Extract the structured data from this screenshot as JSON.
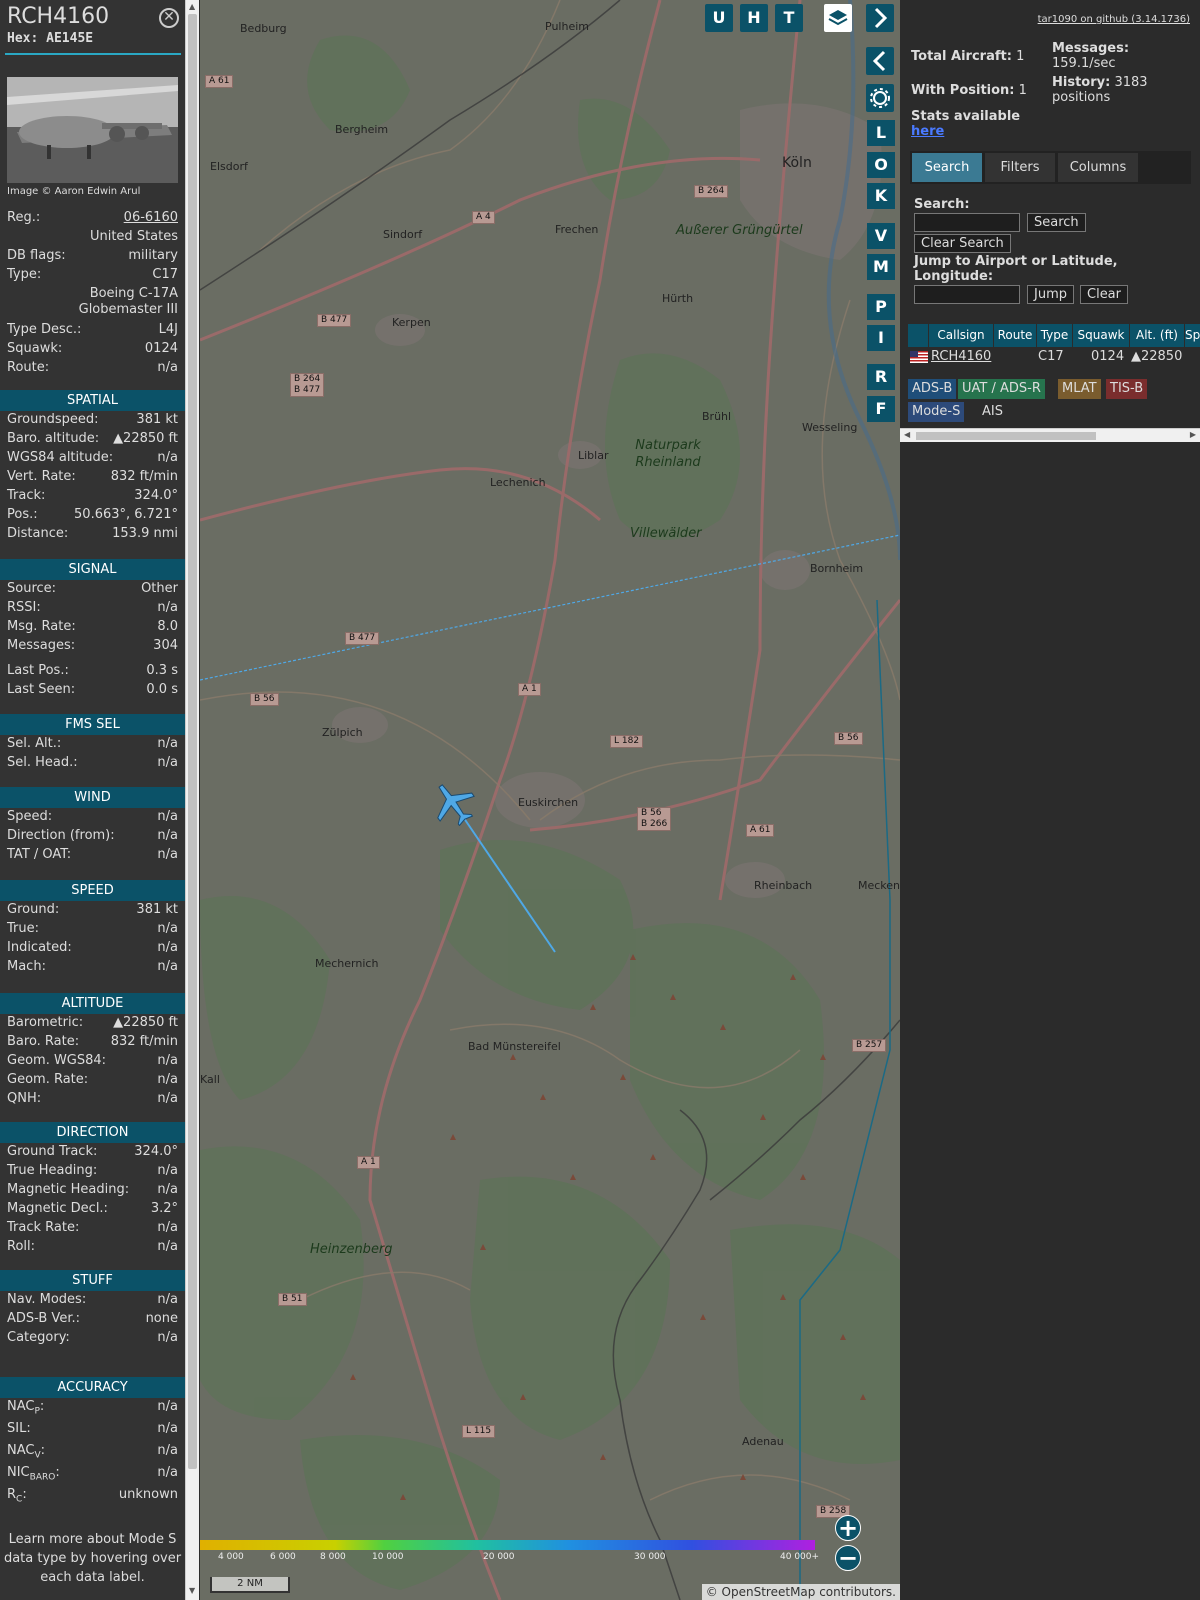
{
  "aircraft": {
    "callsign": "RCH4160",
    "hex_line": "Hex: AE145E",
    "photo_credit": "Image © Aaron Edwin Arul",
    "rows": [
      {
        "k": "Reg.:",
        "v": "06-6160"
      },
      {
        "k": "",
        "v": "United States"
      },
      {
        "k": "DB flags:",
        "v": "military"
      },
      {
        "k": "Type:",
        "v": "C17"
      },
      {
        "k": "",
        "v": "Boeing C-17A"
      },
      {
        "k": "",
        "v": "Globemaster III"
      },
      {
        "k": "Type Desc.:",
        "v": "L4J"
      },
      {
        "k": "Squawk:",
        "v": "0124"
      },
      {
        "k": "Route:",
        "v": "n/a"
      }
    ]
  },
  "sections": {
    "spatial": {
      "title": "SPATIAL",
      "rows": [
        {
          "k": "Groundspeed:",
          "v": "381 kt"
        },
        {
          "k": "Baro. altitude:",
          "v": "▲22850 ft"
        },
        {
          "k": "WGS84 altitude:",
          "v": "n/a"
        },
        {
          "k": "Vert. Rate:",
          "v": "832 ft/min"
        },
        {
          "k": "Track:",
          "v": "324.0°"
        },
        {
          "k": "Pos.:",
          "v": "50.663°, 6.721°"
        },
        {
          "k": "Distance:",
          "v": "153.9 nmi"
        }
      ]
    },
    "signal": {
      "title": "SIGNAL",
      "rows": [
        {
          "k": "Source:",
          "v": "Other"
        },
        {
          "k": "RSSI:",
          "v": "n/a"
        },
        {
          "k": "Msg. Rate:",
          "v": "8.0"
        },
        {
          "k": "Messages:",
          "v": "304"
        },
        {
          "k": "Last Pos.:",
          "v": "0.3 s"
        },
        {
          "k": "Last Seen:",
          "v": "0.0 s"
        }
      ]
    },
    "fms": {
      "title": "FMS SEL",
      "rows": [
        {
          "k": "Sel. Alt.:",
          "v": "n/a"
        },
        {
          "k": "Sel. Head.:",
          "v": "n/a"
        }
      ]
    },
    "wind": {
      "title": "WIND",
      "rows": [
        {
          "k": "Speed:",
          "v": "n/a"
        },
        {
          "k": "Direction (from):",
          "v": "n/a"
        },
        {
          "k": "TAT / OAT:",
          "v": "n/a"
        }
      ]
    },
    "speed": {
      "title": "SPEED",
      "rows": [
        {
          "k": "Ground:",
          "v": "381 kt"
        },
        {
          "k": "True:",
          "v": "n/a"
        },
        {
          "k": "Indicated:",
          "v": "n/a"
        },
        {
          "k": "Mach:",
          "v": "n/a"
        }
      ]
    },
    "altitude": {
      "title": "ALTITUDE",
      "rows": [
        {
          "k": "Barometric:",
          "v": "▲22850 ft"
        },
        {
          "k": "Baro. Rate:",
          "v": "832 ft/min"
        },
        {
          "k": "Geom. WGS84:",
          "v": "n/a"
        },
        {
          "k": "Geom. Rate:",
          "v": "n/a"
        },
        {
          "k": "QNH:",
          "v": "n/a"
        }
      ]
    },
    "direction": {
      "title": "DIRECTION",
      "rows": [
        {
          "k": "Ground Track:",
          "v": "324.0°"
        },
        {
          "k": "True Heading:",
          "v": "n/a"
        },
        {
          "k": "Magnetic Heading:",
          "v": "n/a"
        },
        {
          "k": "Magnetic Decl.:",
          "v": "3.2°"
        },
        {
          "k": "Track Rate:",
          "v": "n/a"
        },
        {
          "k": "Roll:",
          "v": "n/a"
        }
      ]
    },
    "stuff": {
      "title": "STUFF",
      "rows": [
        {
          "k": "Nav. Modes:",
          "v": "n/a"
        },
        {
          "k": "ADS-B Ver.:",
          "v": "none"
        },
        {
          "k": "Category:",
          "v": "n/a"
        }
      ]
    },
    "accuracy": {
      "title": "ACCURACY",
      "rows": [
        {
          "k": "NAC",
          "sub": "P",
          "v": "n/a"
        },
        {
          "k": "SIL:",
          "sub": "",
          "v": "n/a"
        },
        {
          "k": "NAC",
          "sub": "V",
          "v": "n/a"
        },
        {
          "k": "NIC",
          "sub": "BARO",
          "v": "n/a"
        },
        {
          "k": "R",
          "sub": "C",
          "v": "unknown"
        }
      ]
    }
  },
  "learn_more": "Learn more about Mode S data type by hovering over each data label.",
  "map": {
    "toolbar": [
      "U",
      "H",
      "T"
    ],
    "side_buttons": [
      "L",
      "O",
      "K",
      "V",
      "M",
      "P",
      "I",
      "R",
      "F"
    ],
    "places": [
      {
        "name": "Bedburg"
      },
      {
        "name": "Pulheim"
      },
      {
        "name": "Bergheim"
      },
      {
        "name": "Elsdorf"
      },
      {
        "name": "Köln"
      },
      {
        "name": "Sindorf"
      },
      {
        "name": "Frechen"
      },
      {
        "name": "Kerpen"
      },
      {
        "name": "Hürth"
      },
      {
        "name": "Brühl"
      },
      {
        "name": "Wesseling"
      },
      {
        "name": "Liblar"
      },
      {
        "name": "Lechenich"
      },
      {
        "name": "Naturpark Rheinland"
      },
      {
        "name": "Bornheim"
      },
      {
        "name": "Zülpich"
      },
      {
        "name": "Euskirchen"
      },
      {
        "name": "Rheinbach"
      },
      {
        "name": "Mechernich"
      },
      {
        "name": "Bad Münstereifel"
      },
      {
        "name": "Adenau"
      },
      {
        "name": "Heinzenberg"
      },
      {
        "name": "Kall"
      },
      {
        "name": "Villewälder"
      },
      {
        "name": "Außerer Grüngürtel"
      },
      {
        "name": "Meckenh"
      }
    ],
    "roads": [
      "A 61",
      "A 4",
      "B 264",
      "B 477",
      "B 264\nB 477",
      "B 477",
      "B 56",
      "A 1",
      "L 182",
      "B 56\nB 266",
      "A 61",
      "B 56",
      "B 257",
      "A 1",
      "B 51",
      "L 115",
      "B 258"
    ],
    "altitude_scale": [
      "4 000",
      "6 000",
      "8 000",
      "10 000",
      "20 000",
      "30 000",
      "40 000+"
    ],
    "scale_label": "2 NM",
    "attribution": "© OpenStreetMap contributors."
  },
  "right": {
    "github_link": "tar1090 on github (3.14.1736)",
    "total_aircraft_label": "Total Aircraft:",
    "total_aircraft_value": "1",
    "with_position_label": "With Position:",
    "with_position_value": "1",
    "messages_label": "Messages:",
    "messages_value": "159.1/sec",
    "history_label": "History:",
    "history_value": "3183 positions",
    "stats_label": "Stats available",
    "stats_link": "here",
    "tabs": [
      "Search",
      "Filters",
      "Columns"
    ],
    "search_label": "Search:",
    "search_button": "Search",
    "clear_search_button": "Clear Search",
    "jump_label": "Jump to Airport or Latitude, Longitude:",
    "jump_button": "Jump",
    "clear_button": "Clear",
    "columns": [
      "",
      "Callsign",
      "Route",
      "Type",
      "Squawk",
      "Alt. (ft)",
      "Sp"
    ],
    "rows": [
      {
        "callsign": "RCH4160",
        "type": "C17",
        "squawk": "0124",
        "alt": "▲22850"
      }
    ],
    "sources": [
      "ADS-B",
      "UAT / ADS-R",
      "MLAT",
      "TIS-B",
      "Mode-S",
      "AIS"
    ]
  },
  "colors": {
    "panel_header": "#0b5268",
    "accent": "#2aa8c4",
    "aircraft": "#4fa8e6",
    "adsb": "#1f4e79",
    "uat": "#26734d",
    "mlat": "#7a5c2e",
    "tisb": "#7a2d2d",
    "modes": "#2d4a7a"
  }
}
